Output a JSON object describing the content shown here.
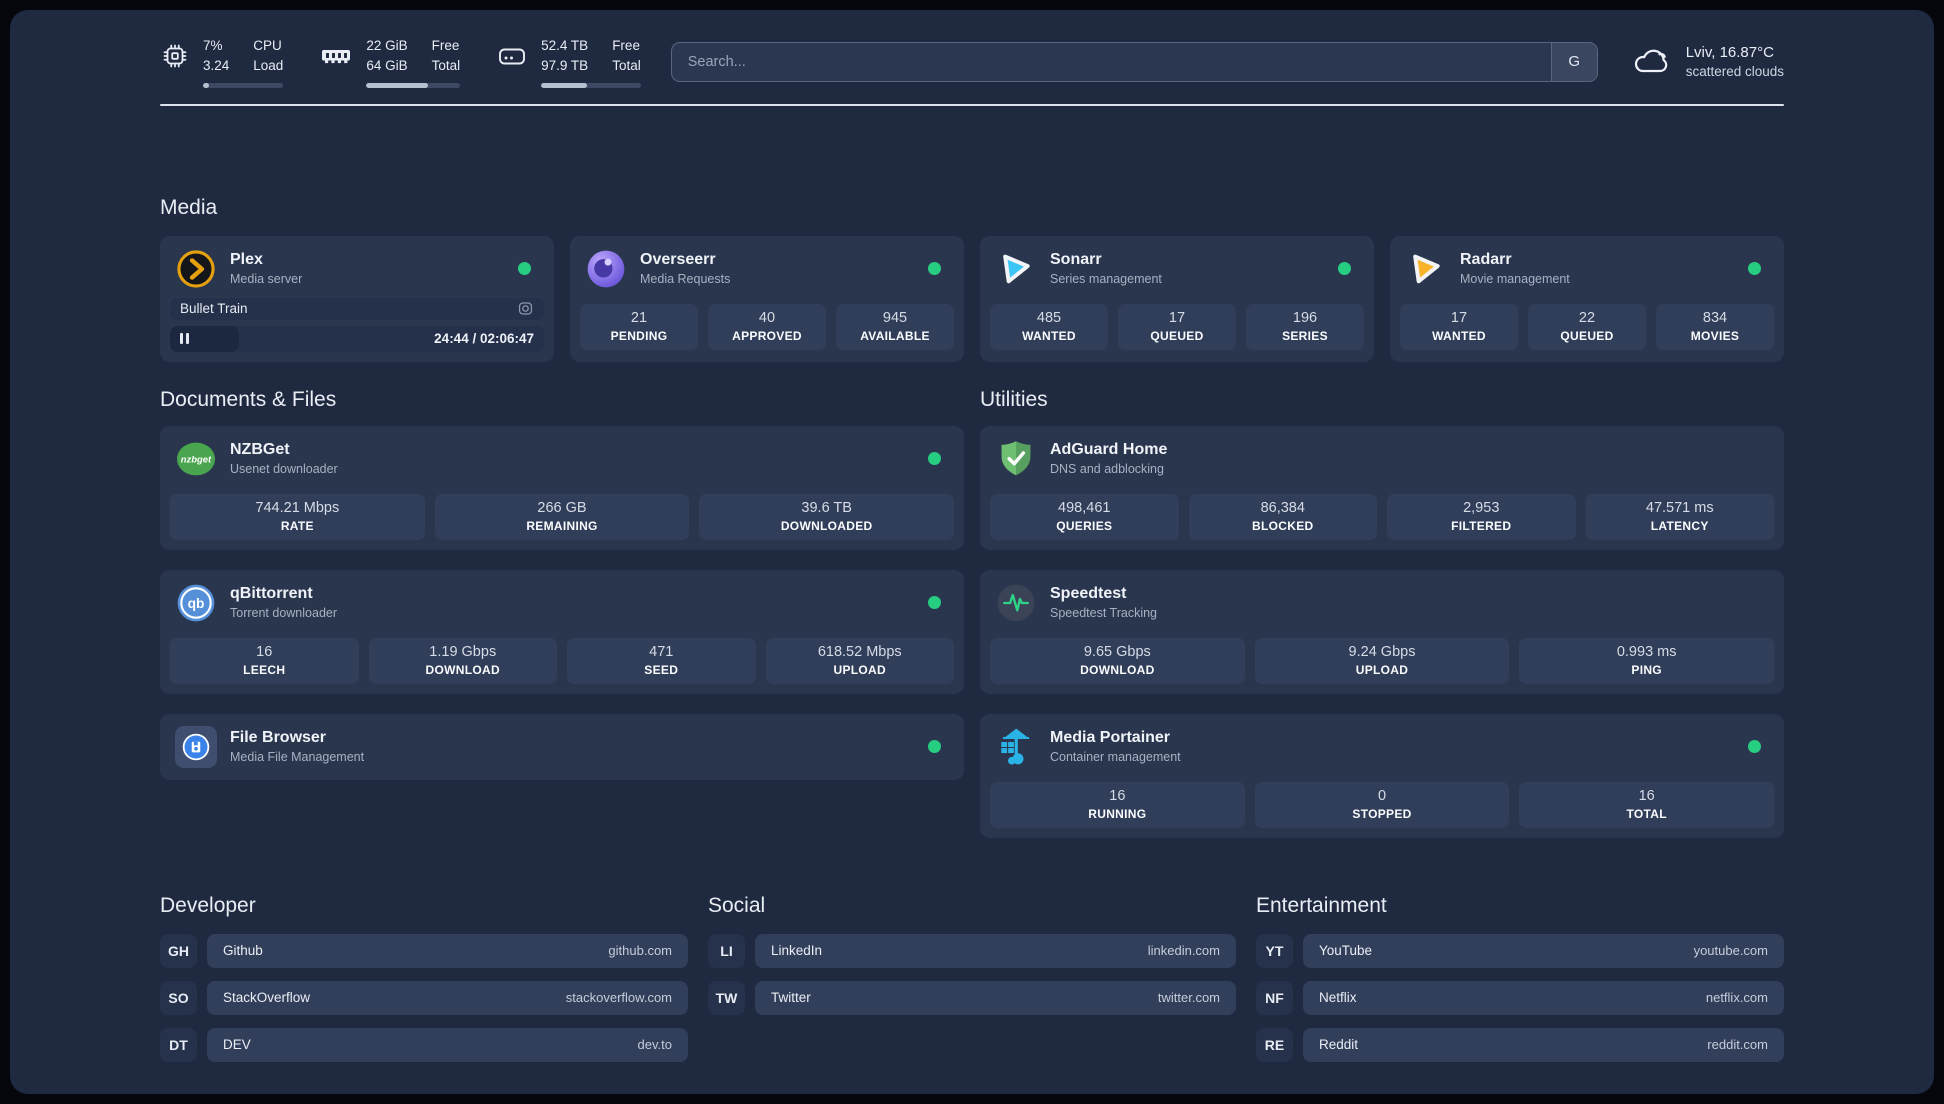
{
  "topbar": {
    "cpu": {
      "value_primary": "7%",
      "value_secondary": "3.24",
      "label_primary": "CPU",
      "label_secondary": "Load",
      "progress_percent": 7
    },
    "memory": {
      "value_primary": "22 GiB",
      "value_secondary": "64 GiB",
      "label_primary": "Free",
      "label_secondary": "Total",
      "progress_percent": 66
    },
    "storage": {
      "value_primary": "52.4 TB",
      "value_secondary": "97.9 TB",
      "label_primary": "Free",
      "label_secondary": "Total",
      "progress_percent": 46
    },
    "search": {
      "placeholder": "Search...",
      "engine_button_label": "G"
    },
    "weather": {
      "location_temp": "Lviv, 16.87°C",
      "condition": "scattered clouds"
    }
  },
  "media_section": {
    "heading": "Media",
    "plex": {
      "title": "Plex",
      "subtitle": "Media server",
      "now_playing": "Bullet Train",
      "time_display": "24:44 / 02:06:47",
      "progress_percent": 19
    },
    "overseerr": {
      "title": "Overseerr",
      "subtitle": "Media Requests",
      "stats": [
        {
          "value": "21",
          "label": "PENDING"
        },
        {
          "value": "40",
          "label": "APPROVED"
        },
        {
          "value": "945",
          "label": "AVAILABLE"
        }
      ]
    },
    "sonarr": {
      "title": "Sonarr",
      "subtitle": "Series management",
      "stats": [
        {
          "value": "485",
          "label": "WANTED"
        },
        {
          "value": "17",
          "label": "QUEUED"
        },
        {
          "value": "196",
          "label": "SERIES"
        }
      ]
    },
    "radarr": {
      "title": "Radarr",
      "subtitle": "Movie management",
      "stats": [
        {
          "value": "17",
          "label": "WANTED"
        },
        {
          "value": "22",
          "label": "QUEUED"
        },
        {
          "value": "834",
          "label": "MOVIES"
        }
      ]
    }
  },
  "documents_section": {
    "heading": "Documents & Files",
    "nzbget": {
      "title": "NZBGet",
      "subtitle": "Usenet downloader",
      "icon_text": "nzbget",
      "stats": [
        {
          "value": "744.21 Mbps",
          "label": "RATE"
        },
        {
          "value": "266 GB",
          "label": "REMAINING"
        },
        {
          "value": "39.6 TB",
          "label": "DOWNLOADED"
        }
      ]
    },
    "qbittorrent": {
      "title": "qBittorrent",
      "subtitle": "Torrent downloader",
      "icon_text": "qb",
      "stats": [
        {
          "value": "16",
          "label": "LEECH"
        },
        {
          "value": "1.19 Gbps",
          "label": "DOWNLOAD"
        },
        {
          "value": "471",
          "label": "SEED"
        },
        {
          "value": "618.52 Mbps",
          "label": "UPLOAD"
        }
      ]
    },
    "filebrowser": {
      "title": "File Browser",
      "subtitle": "Media File Management"
    }
  },
  "utilities_section": {
    "heading": "Utilities",
    "adguard": {
      "title": "AdGuard Home",
      "subtitle": "DNS and adblocking",
      "stats": [
        {
          "value": "498,461",
          "label": "QUERIES"
        },
        {
          "value": "86,384",
          "label": "BLOCKED"
        },
        {
          "value": "2,953",
          "label": "FILTERED"
        },
        {
          "value": "47.571 ms",
          "label": "LATENCY"
        }
      ]
    },
    "speedtest": {
      "title": "Speedtest",
      "subtitle": "Speedtest Tracking",
      "stats": [
        {
          "value": "9.65 Gbps",
          "label": "DOWNLOAD"
        },
        {
          "value": "9.24 Gbps",
          "label": "UPLOAD"
        },
        {
          "value": "0.993 ms",
          "label": "PING"
        }
      ]
    },
    "portainer": {
      "title": "Media Portainer",
      "subtitle": "Container management",
      "stats": [
        {
          "value": "16",
          "label": "RUNNING"
        },
        {
          "value": "0",
          "label": "STOPPED"
        },
        {
          "value": "16",
          "label": "TOTAL"
        }
      ]
    }
  },
  "bookmarks": {
    "developer": {
      "heading": "Developer",
      "links": [
        {
          "tag": "GH",
          "name": "Github",
          "url": "github.com"
        },
        {
          "tag": "SO",
          "name": "StackOverflow",
          "url": "stackoverflow.com"
        },
        {
          "tag": "DT",
          "name": "DEV",
          "url": "dev.to"
        }
      ]
    },
    "social": {
      "heading": "Social",
      "links": [
        {
          "tag": "LI",
          "name": "LinkedIn",
          "url": "linkedin.com"
        },
        {
          "tag": "TW",
          "name": "Twitter",
          "url": "twitter.com"
        }
      ]
    },
    "entertainment": {
      "heading": "Entertainment",
      "links": [
        {
          "tag": "YT",
          "name": "YouTube",
          "url": "youtube.com"
        },
        {
          "tag": "NF",
          "name": "Netflix",
          "url": "netflix.com"
        },
        {
          "tag": "RE",
          "name": "Reddit",
          "url": "reddit.com"
        }
      ]
    }
  },
  "colors": {
    "background": "#1f2a40",
    "card": "#2a364e",
    "tile": "#313e59",
    "status_online": "#27ce82",
    "accent_plex": "#e5a00d",
    "accent_overseerr": "#8b6ef0",
    "accent_sonarr": "#3bc5f4",
    "accent_radarr": "#f8b32a",
    "accent_nzbget": "#4aa64e",
    "accent_qbittorrent": "#5590d9",
    "accent_filebrowser": "#3b82ea",
    "accent_adguard": "#67b779",
    "accent_speedtest": "#2fd388",
    "accent_portainer": "#29b3e6"
  }
}
